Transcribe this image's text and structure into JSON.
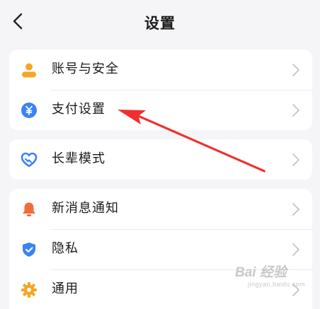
{
  "header": {
    "title": "设置",
    "back_icon": "chevron-left-icon"
  },
  "groups": [
    {
      "items": [
        {
          "label": "账号与安全",
          "icon": "user-icon",
          "icon_color": "#f5a623"
        },
        {
          "label": "支付设置",
          "icon": "yuan-icon",
          "icon_color": "#3b82f6"
        }
      ]
    },
    {
      "items": [
        {
          "label": "长辈模式",
          "icon": "heart-icon",
          "icon_color": "#3b82f6"
        }
      ]
    },
    {
      "items": [
        {
          "label": "新消息通知",
          "icon": "bell-icon",
          "icon_color": "#f26b3a"
        },
        {
          "label": "隐私",
          "icon": "shield-icon",
          "icon_color": "#3b82f6"
        },
        {
          "label": "通用",
          "icon": "gear-icon",
          "icon_color": "#f5a623"
        }
      ]
    }
  ],
  "annotation": {
    "arrow_color": "#f0302e"
  },
  "watermark": {
    "main": "Bai 经验",
    "sub": "jingyan.baidu.com"
  }
}
